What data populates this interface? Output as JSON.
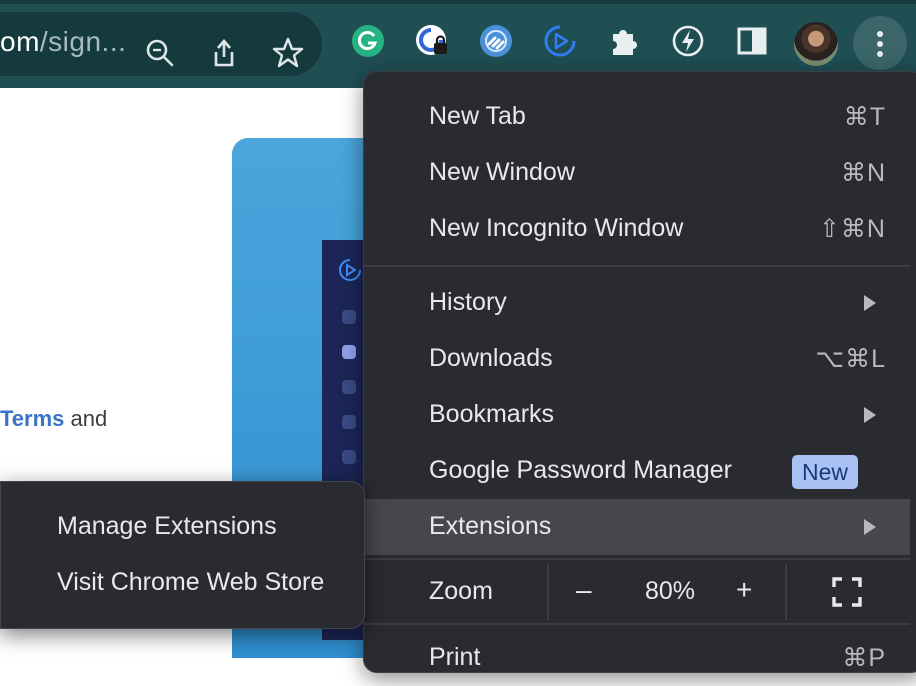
{
  "toolbar": {
    "url_host_fragment": "om",
    "url_path_fragment": "/sign...",
    "icons": [
      "zoom-icon",
      "share-icon",
      "bookmark-star-icon",
      "grammarly-icon",
      "lock-extension-icon",
      "link-extension-icon",
      "play-extension-icon",
      "puzzle-icon",
      "bolt-extension-icon",
      "side-panel-icon",
      "avatar",
      "kebab-menu-icon"
    ],
    "colors": {
      "toolbar_bg": "#1f4e53",
      "omnibox_bg": "#153a3e"
    }
  },
  "page": {
    "terms_link": "Terms",
    "after_link": " and"
  },
  "menu": {
    "items": [
      {
        "label": "New Tab",
        "shortcut": "⌘T"
      },
      {
        "label": "New Window",
        "shortcut": "⌘N"
      },
      {
        "label": "New Incognito Window",
        "shortcut": "⇧⌘N"
      },
      {
        "label": "History",
        "submenu": true
      },
      {
        "label": "Downloads",
        "shortcut": "⌥⌘L"
      },
      {
        "label": "Bookmarks",
        "submenu": true
      },
      {
        "label": "Google Password Manager",
        "badge": "New"
      },
      {
        "label": "Extensions",
        "submenu": true,
        "highlighted": true
      }
    ],
    "zoom": {
      "label": "Zoom",
      "minus": "–",
      "value": "80%",
      "plus": "+"
    },
    "partial_item": {
      "label": "Print",
      "shortcut": "⌘P"
    },
    "colors": {
      "menu_bg": "#2a2b30",
      "highlight": "#45474d",
      "badge_bg": "#a8c2f5"
    }
  },
  "extensions_submenu": {
    "items": [
      {
        "label": "Manage Extensions"
      },
      {
        "label": "Visit Chrome Web Store"
      }
    ]
  }
}
